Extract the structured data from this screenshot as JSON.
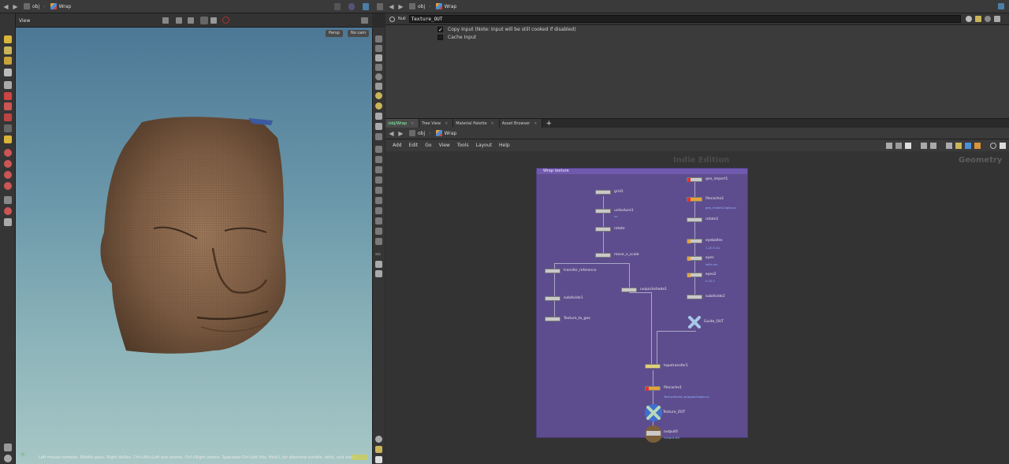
{
  "left_panel": {
    "path": [
      "obj",
      "Wrap"
    ],
    "viewport_label": "View",
    "view_chip": "Persp",
    "camera_chip": "No cam",
    "status": "Left mouse tumbles. Middle pans. Right dollies. Ctrl+Alt+Left box-zooms. Ctrl+Right zooms. Spacebar-Ctrl-Left tilts. Hold L for alternate tumble, dolly, and zoom."
  },
  "param_pane": {
    "path": [
      "obj",
      "Wrap"
    ],
    "node_type": "Null",
    "node_name": "Texture_OUT",
    "params": [
      {
        "label": "Copy Input (Note: Input will be still cooked if disabled)",
        "checked": true
      },
      {
        "label": "Cache Input",
        "checked": false
      }
    ]
  },
  "network_pane": {
    "tabs": [
      "/obj/Wrap",
      "Tree View",
      "Material Palette",
      "Asset Browser"
    ],
    "active_tab": 0,
    "path": [
      "obj",
      "Wrap"
    ],
    "menu": [
      "Add",
      "Edit",
      "Go",
      "View",
      "Tools",
      "Layout",
      "Help"
    ],
    "watermark_edition": "Indie Edition",
    "watermark_context": "Geometry",
    "netbox_title": "Wrap texture",
    "nodes": [
      {
        "label": "grid1",
        "sub": ""
      },
      {
        "label": "uvtexture1",
        "sub": "uv"
      },
      {
        "label": "rotate",
        "sub": ""
      },
      {
        "label": "move_n_scale",
        "sub": ""
      },
      {
        "label": "transfer_reference",
        "sub": ""
      },
      {
        "label": "subdivide1",
        "sub": ""
      },
      {
        "label": "Texture_to_geo",
        "sub": ""
      },
      {
        "label": "uvquickshade1",
        "sub": ""
      },
      {
        "label": "geo_import1",
        "sub": ""
      },
      {
        "label": "filecache2",
        "sub": "geo_model2.bgeo.sc"
      },
      {
        "label": "rotate1",
        "sub": ""
      },
      {
        "label": "eyeballes",
        "sub": "1-20 0.01"
      },
      {
        "label": "eyes",
        "sub": "ialtn.mx"
      },
      {
        "label": "eyes2",
        "sub": "0 10.1"
      },
      {
        "label": "subdivide2",
        "sub": ""
      },
      {
        "label": "Guide_OUT",
        "sub": ""
      },
      {
        "label": "topotransfer1",
        "sub": ""
      },
      {
        "label": "filecache1",
        "sub": "Texturehead_wrapped.bgeo.sc"
      },
      {
        "label": "Texture_OUT",
        "sub": ""
      },
      {
        "label": "output0",
        "sub": "Output #0"
      }
    ]
  },
  "colors": {
    "netbox": "#5e4d8e",
    "netbox_title": "#6f5ab0",
    "viewport_top": "#4c7896",
    "viewport_bottom": "#a8c7c6"
  }
}
